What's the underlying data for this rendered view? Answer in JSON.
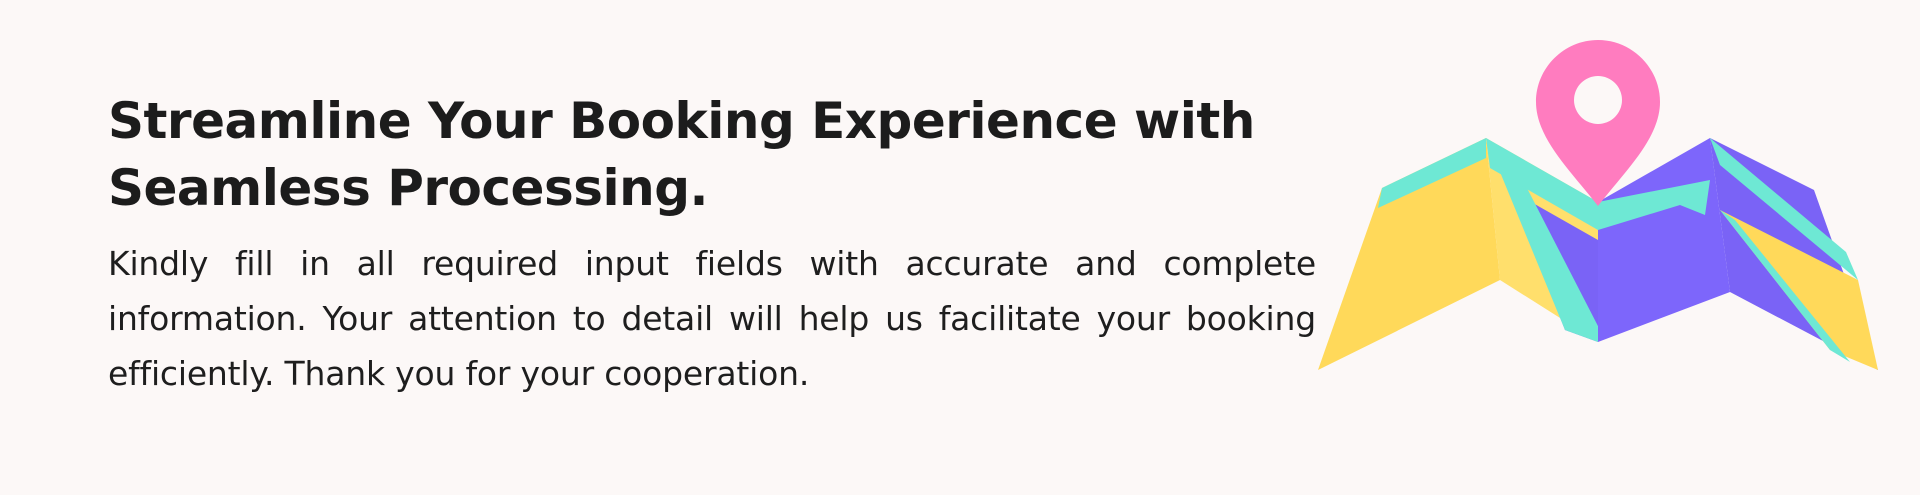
{
  "banner": {
    "headline": "Streamline Your Booking Experience with Seamless Processing.",
    "body": "Kindly fill in all required input fields with accurate and complete information. Your attention to detail will help us facilitate your booking efficiently. Thank you for your cooperation.",
    "illustration": {
      "icon": "map-pin-icon",
      "colors": {
        "pin": "#ff7cbf",
        "fold_yellow": "#ffd95a",
        "road_teal": "#6ee8d4",
        "fold_purple": "#7a63f6",
        "background": "#fcf8f7"
      }
    }
  }
}
